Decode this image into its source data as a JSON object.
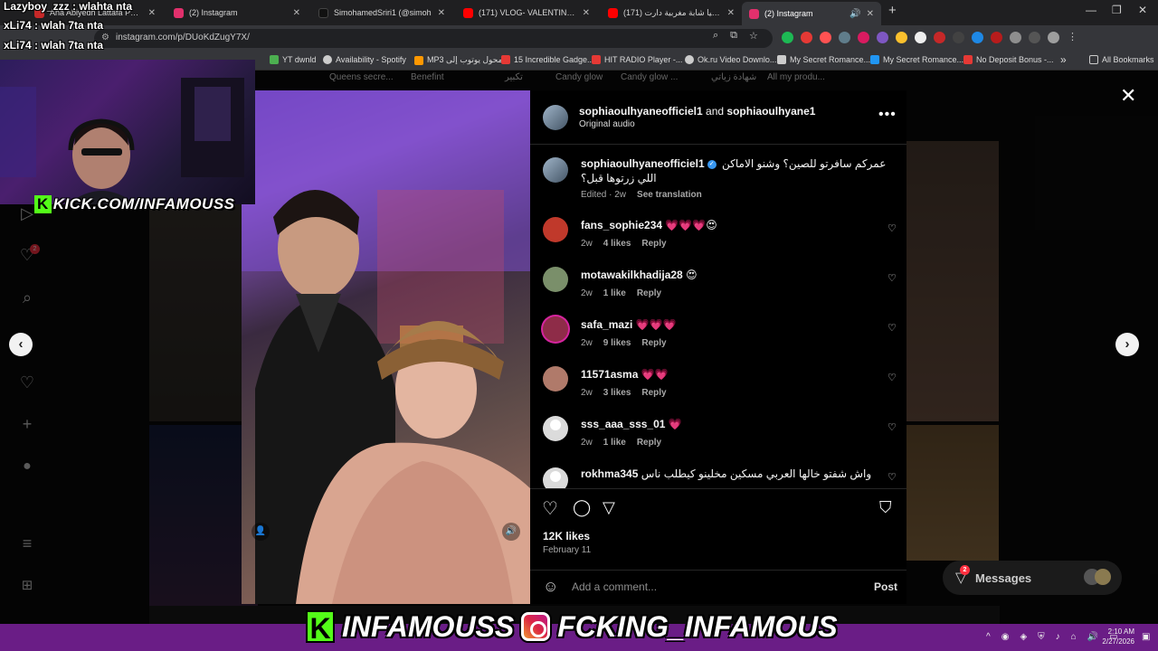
{
  "browser": {
    "tabs": [
      {
        "label": "Ana Abiyedh Lattafa Perfumes",
        "favicon_color": "#c62828"
      },
      {
        "label": "(2) Instagram",
        "favicon_color": "#e1306c"
      },
      {
        "label": "SimohamedSriri1 (@simoh",
        "favicon_color": "#111111"
      },
      {
        "label": "(171) VLOG- VALENTINES DAY",
        "favicon_color": "#ff0000"
      },
      {
        "label": "(171) صوفيا شابة مغربية دارت",
        "favicon_color": "#ff0000"
      },
      {
        "label": "(2) Instagram",
        "favicon_color": "#e1306c"
      }
    ],
    "new_tab": "+",
    "url": "instagram.com/p/DUoKdZugY7X/",
    "bookmarks": [
      {
        "label": "YT dwnld",
        "color": "#4caf50"
      },
      {
        "label": "Availability - Spotify",
        "color": "#cccccc"
      },
      {
        "label": "MP3 محول يوتوب إلى",
        "color": "#ff9800"
      },
      {
        "label": "15 Incredible Gadge...",
        "color": "#e53935"
      },
      {
        "label": "HIT RADIO Player -...",
        "color": "#e53935"
      },
      {
        "label": "Ok.ru Video Downlo...",
        "color": "#cccccc"
      },
      {
        "label": "My Secret Romance...",
        "color": "#cccccc"
      },
      {
        "label": "My Secret Romance...",
        "color": "#2196f3"
      },
      {
        "label": "No Deposit Bonus -...",
        "color": "#e53935"
      }
    ],
    "more_bookmarks": "»",
    "all_bookmarks": "All Bookmarks"
  },
  "background_faded_tags": [
    "Queens secre...",
    "Benefint",
    "تكبير",
    "Candy glow",
    "Candy glow ...",
    "شهادة زياتي",
    "All my produ..."
  ],
  "post": {
    "header": {
      "user1": "sophiaoulhyaneofficiel1",
      "joiner": "and",
      "user2": "sophiaoulhyane1",
      "audio": "Original audio",
      "more": "•••"
    },
    "caption": {
      "username": "sophiaoulhyaneofficiel1",
      "verified": true,
      "text_line1": "عمركم سافرتو للصين؟ وشنو الاماكن",
      "text_line2": "اللي زرتوها قبل؟",
      "edited": "Edited · 2w",
      "see_translation": "See translation"
    },
    "comments": [
      {
        "username": "fans_sophie234",
        "text": "💗💗💗😍",
        "age": "2w",
        "likes": "4 likes",
        "reply": "Reply",
        "avatar_color": "#c0392b"
      },
      {
        "username": "motawakilkhadija28",
        "text": "😍",
        "age": "2w",
        "likes": "1 like",
        "reply": "Reply",
        "avatar_color": "#7a8f6a"
      },
      {
        "username": "safa_mazi",
        "text": "💗💗💗",
        "age": "2w",
        "likes": "9 likes",
        "reply": "Reply",
        "avatar_color": "#8e2c48"
      },
      {
        "username": "11571asma",
        "text": "💗💗",
        "age": "2w",
        "likes": "3 likes",
        "reply": "Reply",
        "avatar_color": "#b07a6a"
      },
      {
        "username": "sss_aaa_sss_01",
        "text": "💗",
        "age": "2w",
        "likes": "1 like",
        "reply": "Reply",
        "avatar_color": "#dbdbdb"
      },
      {
        "username": "rokhma345",
        "text": "واش شفتو خالها العربي مسكين مخلينو كيطلب ناس",
        "age": "",
        "likes": "",
        "reply": "",
        "avatar_color": "#dbdbdb"
      }
    ],
    "likes": "12K likes",
    "date": "February 11",
    "add_comment_placeholder": "Add a comment...",
    "post_button": "Post"
  },
  "messages": {
    "label": "Messages",
    "badge": "2"
  },
  "sidebar": {
    "notifications_badge": "2"
  },
  "stream": {
    "chat": [
      {
        "user": "Lazyboy_zzz",
        "text": "wlahta nta"
      },
      {
        "user": "xLi74",
        "text": "wlah 7ta nta"
      },
      {
        "user": "xLi74",
        "text": "wlah 7ta nta"
      }
    ],
    "kick_url": "KICK.COM/INFAMOUSS",
    "banner_name": "INFAMOUSS",
    "banner_handle": "FCKING_INFAMOUS"
  },
  "taskbar": {
    "time": "2:10 AM",
    "date": "2/27/2026"
  }
}
